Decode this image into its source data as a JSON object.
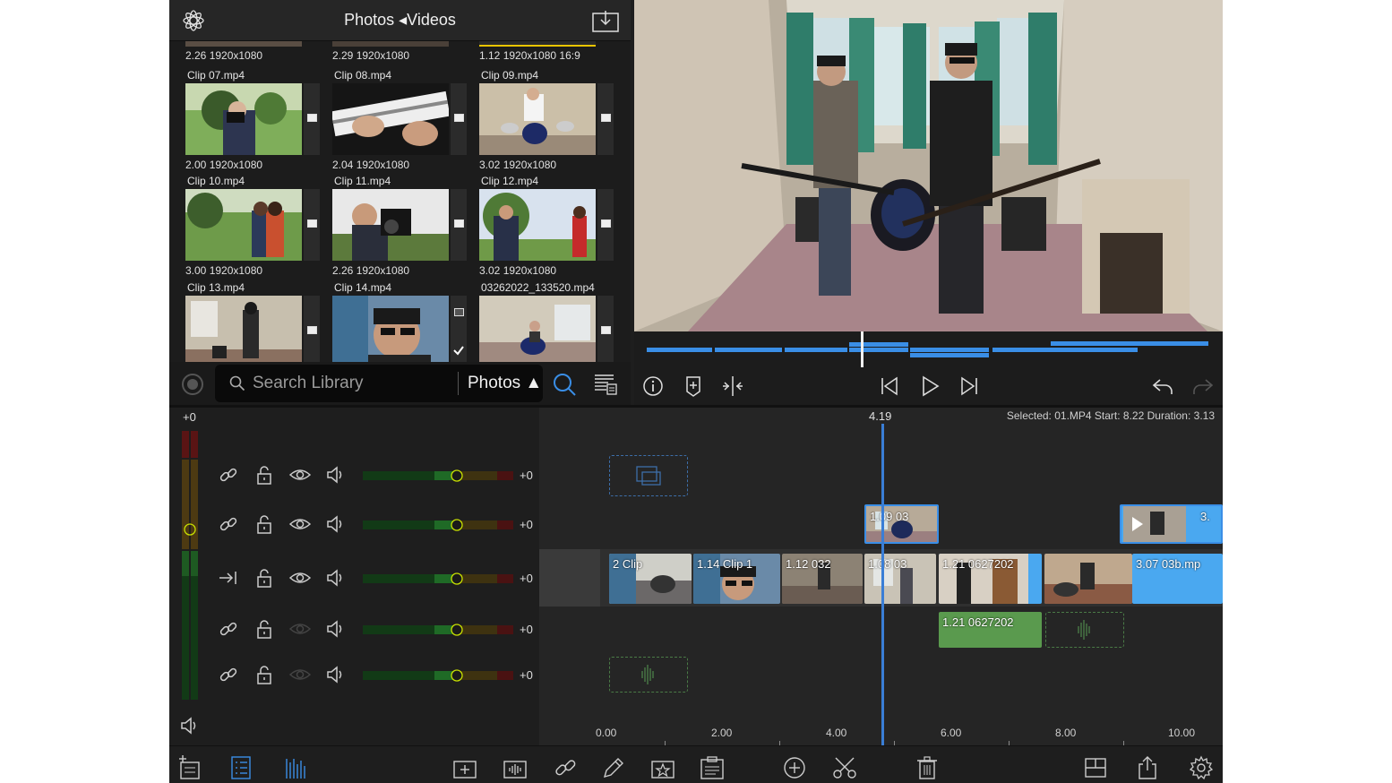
{
  "library": {
    "title": "Photos ◂Videos",
    "top_row_meta": [
      "2.26  1920x1080",
      "2.29  1920x1080",
      "1.12  1920x1080  16:9"
    ],
    "clips": [
      {
        "name": "Clip 07.mp4",
        "meta": "2.00  1920x1080"
      },
      {
        "name": "Clip 08.mp4",
        "meta": "2.04  1920x1080"
      },
      {
        "name": "Clip 09.mp4",
        "meta": "3.02  1920x1080"
      },
      {
        "name": "Clip 10.mp4",
        "meta": "3.00  1920x1080"
      },
      {
        "name": "Clip 11.mp4",
        "meta": "2.26  1920x1080"
      },
      {
        "name": "Clip 12.mp4",
        "meta": "3.02  1920x1080"
      },
      {
        "name": "Clip 13.mp4",
        "meta": ""
      },
      {
        "name": "Clip 14.mp4",
        "meta": ""
      },
      {
        "name": "03262022_133520.mp4",
        "meta": ""
      }
    ],
    "search": {
      "placeholder": "Search Library",
      "value": ""
    },
    "source": "Photos ▲"
  },
  "timeline": {
    "master_gain": "+0",
    "time_readout": "4.19",
    "selected_info": "Selected:  01.MP4 Start: 8.22 Duration: 3.13",
    "track_gains": [
      "+0",
      "+0",
      "+0",
      "+0",
      "+0"
    ],
    "clip_labels": {
      "v1_a": "1.09   03",
      "v1_b": "3.",
      "main_1": "2  Clip",
      "main_2": "1.14   Clip 1",
      "main_3": "1.12   032",
      "main_4": "1.08   03",
      "main_5": "1.21   0627202",
      "main_7": "3.07   03b.mp",
      "audio_1": "1.21   0627202"
    },
    "ruler": [
      "0.00",
      "2.00",
      "4.00",
      "6.00",
      "8.00",
      "10.00"
    ]
  },
  "colors": {
    "accent_blue": "#3a8ee6",
    "selected_clip": "#4aa8f0",
    "audio_clip": "#5a9a4e",
    "playhead": "#3a7ed6"
  }
}
